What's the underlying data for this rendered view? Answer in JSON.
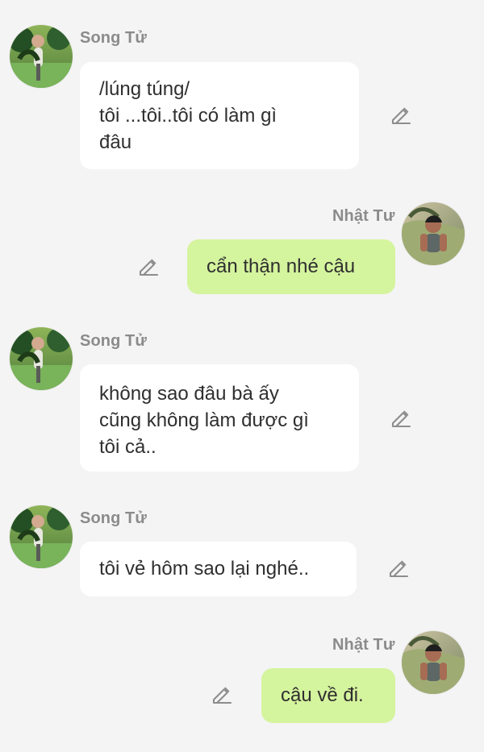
{
  "colors": {
    "background": "#f4f4f4",
    "left_bubble": "#ffffff",
    "right_bubble": "#d5f49e",
    "name_text": "#8b8b8b",
    "message_text": "#2f2f2f",
    "edit_icon": "#8d8d8d"
  },
  "messages": [
    {
      "sender": "Song Tử",
      "avatar_icon": "avatar-icon",
      "lines": [
        "/lúng túng/",
        "tôi ...tôi..tôi có làm gì",
        "đâu"
      ],
      "edit_icon": "pencil-edit-icon"
    },
    {
      "sender": "Nhật Tư",
      "avatar_icon": "avatar-icon",
      "lines": [
        "cẩn thận nhé cậu"
      ],
      "edit_icon": "pencil-edit-icon"
    },
    {
      "sender": "Song Tử",
      "avatar_icon": "avatar-icon",
      "lines": [
        "không sao đâu bà ấy",
        "cũng không làm được gì",
        "tôi cả.."
      ],
      "edit_icon": "pencil-edit-icon"
    },
    {
      "sender": "Song Tử",
      "avatar_icon": "avatar-icon",
      "lines": [
        "tôi vẻ hôm sao lại nghé.."
      ],
      "edit_icon": "pencil-edit-icon"
    },
    {
      "sender": "Nhật Tư",
      "avatar_icon": "avatar-icon",
      "lines": [
        "cậu về đi."
      ],
      "edit_icon": "pencil-edit-icon"
    }
  ]
}
